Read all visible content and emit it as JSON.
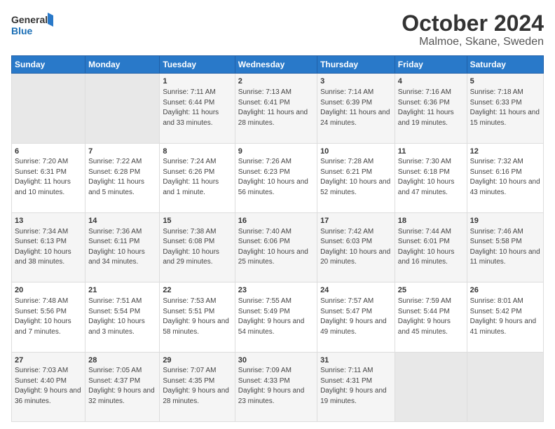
{
  "logo": {
    "line1": "General",
    "line2": "Blue"
  },
  "title": "October 2024",
  "subtitle": "Malmoe, Skane, Sweden",
  "headers": [
    "Sunday",
    "Monday",
    "Tuesday",
    "Wednesday",
    "Thursday",
    "Friday",
    "Saturday"
  ],
  "rows": [
    [
      {
        "empty": true
      },
      {
        "empty": true
      },
      {
        "num": "1",
        "sunrise": "Sunrise: 7:11 AM",
        "sunset": "Sunset: 6:44 PM",
        "daylight": "Daylight: 11 hours and 33 minutes."
      },
      {
        "num": "2",
        "sunrise": "Sunrise: 7:13 AM",
        "sunset": "Sunset: 6:41 PM",
        "daylight": "Daylight: 11 hours and 28 minutes."
      },
      {
        "num": "3",
        "sunrise": "Sunrise: 7:14 AM",
        "sunset": "Sunset: 6:39 PM",
        "daylight": "Daylight: 11 hours and 24 minutes."
      },
      {
        "num": "4",
        "sunrise": "Sunrise: 7:16 AM",
        "sunset": "Sunset: 6:36 PM",
        "daylight": "Daylight: 11 hours and 19 minutes."
      },
      {
        "num": "5",
        "sunrise": "Sunrise: 7:18 AM",
        "sunset": "Sunset: 6:33 PM",
        "daylight": "Daylight: 11 hours and 15 minutes."
      }
    ],
    [
      {
        "num": "6",
        "sunrise": "Sunrise: 7:20 AM",
        "sunset": "Sunset: 6:31 PM",
        "daylight": "Daylight: 11 hours and 10 minutes."
      },
      {
        "num": "7",
        "sunrise": "Sunrise: 7:22 AM",
        "sunset": "Sunset: 6:28 PM",
        "daylight": "Daylight: 11 hours and 5 minutes."
      },
      {
        "num": "8",
        "sunrise": "Sunrise: 7:24 AM",
        "sunset": "Sunset: 6:26 PM",
        "daylight": "Daylight: 11 hours and 1 minute."
      },
      {
        "num": "9",
        "sunrise": "Sunrise: 7:26 AM",
        "sunset": "Sunset: 6:23 PM",
        "daylight": "Daylight: 10 hours and 56 minutes."
      },
      {
        "num": "10",
        "sunrise": "Sunrise: 7:28 AM",
        "sunset": "Sunset: 6:21 PM",
        "daylight": "Daylight: 10 hours and 52 minutes."
      },
      {
        "num": "11",
        "sunrise": "Sunrise: 7:30 AM",
        "sunset": "Sunset: 6:18 PM",
        "daylight": "Daylight: 10 hours and 47 minutes."
      },
      {
        "num": "12",
        "sunrise": "Sunrise: 7:32 AM",
        "sunset": "Sunset: 6:16 PM",
        "daylight": "Daylight: 10 hours and 43 minutes."
      }
    ],
    [
      {
        "num": "13",
        "sunrise": "Sunrise: 7:34 AM",
        "sunset": "Sunset: 6:13 PM",
        "daylight": "Daylight: 10 hours and 38 minutes."
      },
      {
        "num": "14",
        "sunrise": "Sunrise: 7:36 AM",
        "sunset": "Sunset: 6:11 PM",
        "daylight": "Daylight: 10 hours and 34 minutes."
      },
      {
        "num": "15",
        "sunrise": "Sunrise: 7:38 AM",
        "sunset": "Sunset: 6:08 PM",
        "daylight": "Daylight: 10 hours and 29 minutes."
      },
      {
        "num": "16",
        "sunrise": "Sunrise: 7:40 AM",
        "sunset": "Sunset: 6:06 PM",
        "daylight": "Daylight: 10 hours and 25 minutes."
      },
      {
        "num": "17",
        "sunrise": "Sunrise: 7:42 AM",
        "sunset": "Sunset: 6:03 PM",
        "daylight": "Daylight: 10 hours and 20 minutes."
      },
      {
        "num": "18",
        "sunrise": "Sunrise: 7:44 AM",
        "sunset": "Sunset: 6:01 PM",
        "daylight": "Daylight: 10 hours and 16 minutes."
      },
      {
        "num": "19",
        "sunrise": "Sunrise: 7:46 AM",
        "sunset": "Sunset: 5:58 PM",
        "daylight": "Daylight: 10 hours and 11 minutes."
      }
    ],
    [
      {
        "num": "20",
        "sunrise": "Sunrise: 7:48 AM",
        "sunset": "Sunset: 5:56 PM",
        "daylight": "Daylight: 10 hours and 7 minutes."
      },
      {
        "num": "21",
        "sunrise": "Sunrise: 7:51 AM",
        "sunset": "Sunset: 5:54 PM",
        "daylight": "Daylight: 10 hours and 3 minutes."
      },
      {
        "num": "22",
        "sunrise": "Sunrise: 7:53 AM",
        "sunset": "Sunset: 5:51 PM",
        "daylight": "Daylight: 9 hours and 58 minutes."
      },
      {
        "num": "23",
        "sunrise": "Sunrise: 7:55 AM",
        "sunset": "Sunset: 5:49 PM",
        "daylight": "Daylight: 9 hours and 54 minutes."
      },
      {
        "num": "24",
        "sunrise": "Sunrise: 7:57 AM",
        "sunset": "Sunset: 5:47 PM",
        "daylight": "Daylight: 9 hours and 49 minutes."
      },
      {
        "num": "25",
        "sunrise": "Sunrise: 7:59 AM",
        "sunset": "Sunset: 5:44 PM",
        "daylight": "Daylight: 9 hours and 45 minutes."
      },
      {
        "num": "26",
        "sunrise": "Sunrise: 8:01 AM",
        "sunset": "Sunset: 5:42 PM",
        "daylight": "Daylight: 9 hours and 41 minutes."
      }
    ],
    [
      {
        "num": "27",
        "sunrise": "Sunrise: 7:03 AM",
        "sunset": "Sunset: 4:40 PM",
        "daylight": "Daylight: 9 hours and 36 minutes."
      },
      {
        "num": "28",
        "sunrise": "Sunrise: 7:05 AM",
        "sunset": "Sunset: 4:37 PM",
        "daylight": "Daylight: 9 hours and 32 minutes."
      },
      {
        "num": "29",
        "sunrise": "Sunrise: 7:07 AM",
        "sunset": "Sunset: 4:35 PM",
        "daylight": "Daylight: 9 hours and 28 minutes."
      },
      {
        "num": "30",
        "sunrise": "Sunrise: 7:09 AM",
        "sunset": "Sunset: 4:33 PM",
        "daylight": "Daylight: 9 hours and 23 minutes."
      },
      {
        "num": "31",
        "sunrise": "Sunrise: 7:11 AM",
        "sunset": "Sunset: 4:31 PM",
        "daylight": "Daylight: 9 hours and 19 minutes."
      },
      {
        "empty": true
      },
      {
        "empty": true
      }
    ]
  ]
}
